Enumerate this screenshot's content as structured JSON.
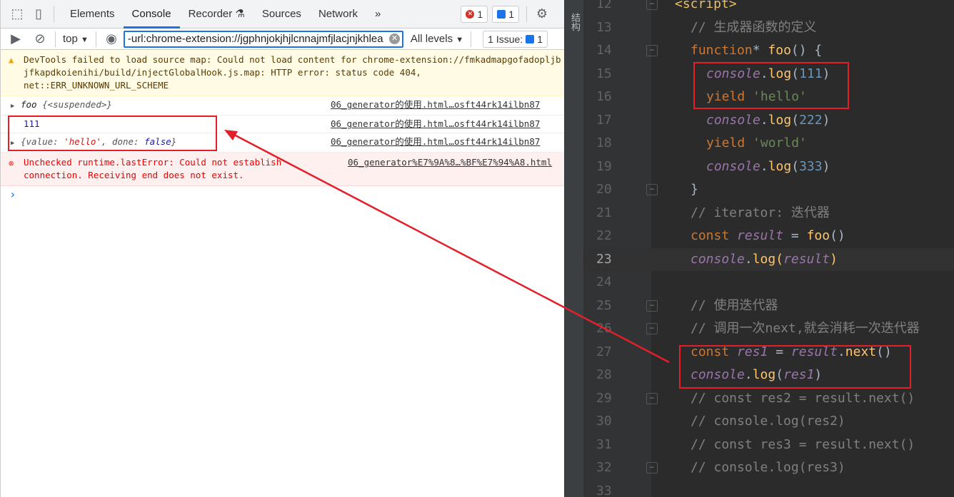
{
  "devtools": {
    "tabs": [
      "Elements",
      "Console",
      "Recorder",
      "Sources",
      "Network"
    ],
    "active_tab": "Console",
    "more": "»",
    "error_count": "1",
    "info_count": "1",
    "context": "top",
    "filter_value": "-url:chrome-extension://jgphnjokjhjlcnnajmfjlacjnjkhlea",
    "levels": "All levels",
    "issues": "1 Issue:",
    "issues_count": "1",
    "warning": {
      "text1": "DevTools failed to load source map: Could not load content for ",
      "link": "chrome-extension://fmkadmapgofadopljbjfkapdkoienihi/build/injectGlobalHook.js.map",
      "text2": ": HTTP error: status code 404, net::ERR_UNKNOWN_URL_SCHEME"
    },
    "logs": [
      {
        "a": "foo ",
        "b": "{<suspended>}",
        "src": "06_generator的使用.html…osft44rk14ilbn87"
      },
      {
        "a": "111",
        "src": "06_generator的使用.html…osft44rk14ilbn87"
      },
      {
        "a": "{value: ",
        "s": "'hello'",
        "c": ", done: ",
        "f": "false",
        "d": "}",
        "src": "06_generator的使用.html…osft44rk14ilbn87"
      }
    ],
    "error": {
      "text": "Unchecked runtime.lastError: Could not establish connection. Receiving end does not exist.",
      "src": "06_generator%E7%9A%8…%BF%E7%94%A8.html"
    },
    "prompt": "›"
  },
  "editor": {
    "side_label": "结构",
    "lines": [
      {
        "n": "12",
        "i": 0,
        "fold": "−",
        "t": [
          [
            "tag",
            "<script>"
          ]
        ]
      },
      {
        "n": "13",
        "i": 1,
        "t": [
          [
            "com",
            "// 生成器函数的定义"
          ]
        ]
      },
      {
        "n": "14",
        "i": 1,
        "fold": "−",
        "t": [
          [
            "kw",
            "function"
          ],
          [
            "def",
            "* "
          ],
          [
            "fn",
            "foo"
          ],
          [
            "def",
            "() {"
          ]
        ]
      },
      {
        "n": "15",
        "i": 2,
        "t": [
          [
            "con",
            "console"
          ],
          [
            "def",
            "."
          ],
          [
            "fn",
            "log"
          ],
          [
            "def",
            "("
          ],
          [
            "num",
            "111"
          ],
          [
            "def",
            ")"
          ]
        ]
      },
      {
        "n": "16",
        "i": 2,
        "t": [
          [
            "kw",
            "yield "
          ],
          [
            "str",
            "'hello'"
          ]
        ]
      },
      {
        "n": "17",
        "i": 2,
        "t": [
          [
            "con",
            "console"
          ],
          [
            "def",
            "."
          ],
          [
            "fn",
            "log"
          ],
          [
            "def",
            "("
          ],
          [
            "num",
            "222"
          ],
          [
            "def",
            ")"
          ]
        ]
      },
      {
        "n": "18",
        "i": 2,
        "t": [
          [
            "kw",
            "yield "
          ],
          [
            "str",
            "'world'"
          ]
        ]
      },
      {
        "n": "19",
        "i": 2,
        "t": [
          [
            "con",
            "console"
          ],
          [
            "def",
            "."
          ],
          [
            "fn",
            "log"
          ],
          [
            "def",
            "("
          ],
          [
            "num",
            "333"
          ],
          [
            "def",
            ")"
          ]
        ]
      },
      {
        "n": "20",
        "i": 1,
        "fold": "−",
        "t": [
          [
            "def",
            "}"
          ]
        ]
      },
      {
        "n": "21",
        "i": 1,
        "t": [
          [
            "com",
            "// iterator: 迭代器"
          ]
        ]
      },
      {
        "n": "22",
        "i": 1,
        "t": [
          [
            "kw",
            "const "
          ],
          [
            "var",
            "result"
          ],
          [
            "def",
            " = "
          ],
          [
            "fn",
            "foo"
          ],
          [
            "def",
            "()"
          ]
        ]
      },
      {
        "n": "23",
        "i": 1,
        "cur": true,
        "t": [
          [
            "con",
            "console"
          ],
          [
            "def",
            "."
          ],
          [
            "fn",
            "log"
          ],
          [
            "fn",
            "("
          ],
          [
            "var",
            "result"
          ],
          [
            "fn",
            ")"
          ]
        ]
      },
      {
        "n": "24",
        "i": 1,
        "t": []
      },
      {
        "n": "25",
        "i": 1,
        "fold": "−",
        "t": [
          [
            "com",
            "// 使用迭代器"
          ]
        ]
      },
      {
        "n": "26",
        "i": 1,
        "fold": "−",
        "t": [
          [
            "com",
            "// 调用一次next,就会消耗一次迭代器"
          ]
        ]
      },
      {
        "n": "27",
        "i": 1,
        "t": [
          [
            "kw",
            "const "
          ],
          [
            "var",
            "res1"
          ],
          [
            "def",
            " = "
          ],
          [
            "var",
            "result"
          ],
          [
            "def",
            "."
          ],
          [
            "fn",
            "next"
          ],
          [
            "def",
            "()"
          ]
        ]
      },
      {
        "n": "28",
        "i": 1,
        "t": [
          [
            "con",
            "console"
          ],
          [
            "def",
            "."
          ],
          [
            "fn",
            "log"
          ],
          [
            "def",
            "("
          ],
          [
            "var",
            "res1"
          ],
          [
            "def",
            ")"
          ]
        ]
      },
      {
        "n": "29",
        "i": 1,
        "fold": "−",
        "t": [
          [
            "com",
            "// const res2 = result.next()"
          ]
        ]
      },
      {
        "n": "30",
        "i": 1,
        "t": [
          [
            "com",
            "// console.log(res2)"
          ]
        ]
      },
      {
        "n": "31",
        "i": 1,
        "t": [
          [
            "com",
            "// const res3 = result.next()"
          ]
        ]
      },
      {
        "n": "32",
        "i": 1,
        "fold": "−",
        "t": [
          [
            "com",
            "// console.log(res3)"
          ]
        ]
      },
      {
        "n": "33",
        "i": 1,
        "t": []
      }
    ]
  },
  "colors": {
    "annotation": "#e3202a",
    "accent": "#1a73e8"
  }
}
